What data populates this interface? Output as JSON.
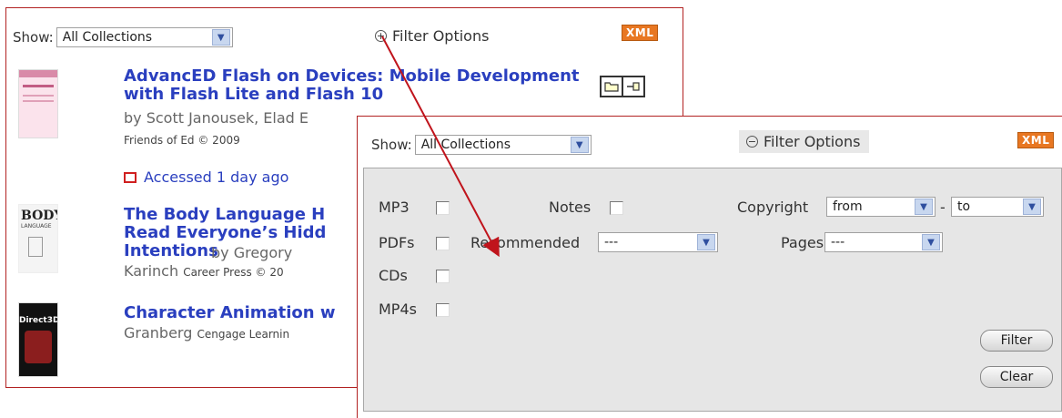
{
  "back": {
    "show_label": "Show:",
    "collection_value": "All Collections",
    "filter_toggle": "Filter Options",
    "xml": "XML",
    "books": [
      {
        "title": "AdvancED Flash on Devices: Mobile Development with Flash Lite and Flash 10",
        "author": "by Scott Janousek, Elad E",
        "publisher": "Friends of Ed © 2009",
        "accessed": "Accessed 1 day ago"
      },
      {
        "title": "The Body Language H Read Everyone’s Hidd Intentions",
        "author": "by Gregory",
        "author_line2": "Karinch",
        "publisher": "Career Press © 20"
      },
      {
        "title": "Character Animation w",
        "author": "Granberg",
        "publisher": "Cengage Learnin"
      }
    ]
  },
  "front": {
    "show_label": "Show:",
    "collection_value": "All Collections",
    "filter_toggle": "Filter Options",
    "xml": "XML",
    "filters": {
      "mp3": "MP3",
      "pdfs": "PDFs",
      "cds": "CDs",
      "mp4s": "MP4s",
      "notes": "Notes",
      "recommended": "Recommended",
      "recommended_value": "---",
      "copyright": "Copyright",
      "from_value": "from",
      "dash": "-",
      "to_value": "to",
      "pages": "Pages",
      "pages_value": "---"
    },
    "buttons": {
      "filter": "Filter",
      "clear": "Clear"
    }
  },
  "colors": {
    "accent": "#b22222",
    "link": "#2a3fbf",
    "xml": "#e87722"
  }
}
